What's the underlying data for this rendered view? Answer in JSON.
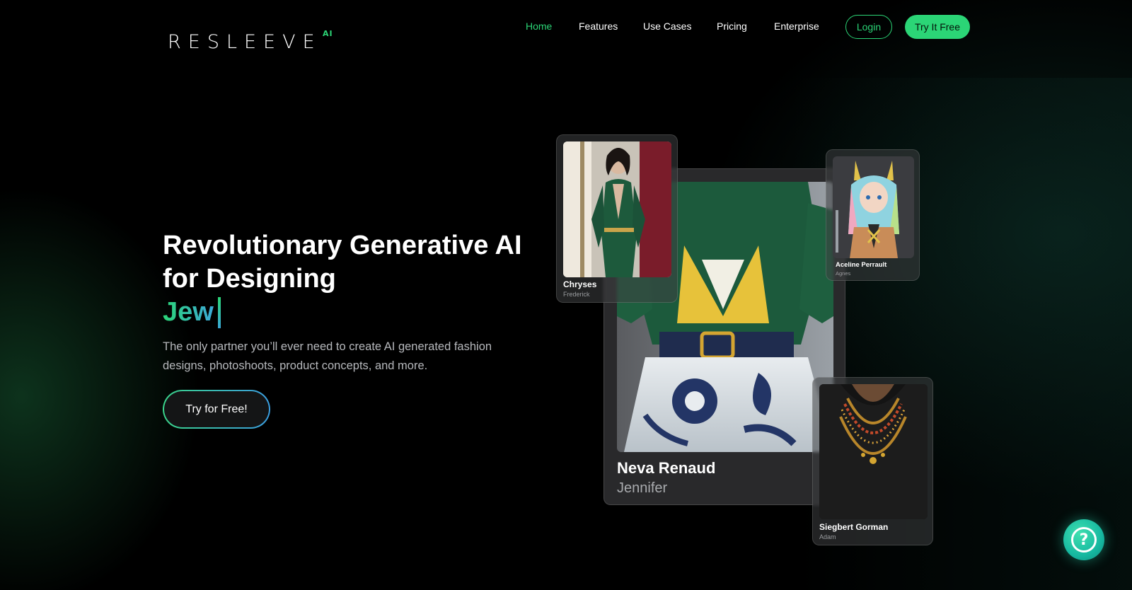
{
  "brand": {
    "logo_text": "RESLEEVE",
    "logo_super": "AI"
  },
  "nav": {
    "items": [
      {
        "label": "Home",
        "active": true
      },
      {
        "label": "Features"
      },
      {
        "label": "Use Cases"
      },
      {
        "label": "Pricing"
      },
      {
        "label": "Enterprise"
      }
    ],
    "login_label": "Login",
    "try_label": "Try It Free"
  },
  "hero": {
    "title": "Revolutionary Generative AI for Designing",
    "typed_text": "Jew",
    "subtitle": "The only partner you’ll ever need to create AI generated fashion designs, photoshoots, product concepts, and more.",
    "cta_label": "Try for Free!"
  },
  "cards": {
    "main": {
      "name": "Neva Renaud",
      "sub": "Jennifer"
    },
    "top_left": {
      "name": "Chryses",
      "sub": "Frederick"
    },
    "top_right": {
      "name": "Aceline Perrault",
      "sub": "Agnes"
    },
    "bottom_right": {
      "name": "Siegbert Gorman",
      "sub": "Adam"
    }
  },
  "help": {
    "icon": "question-icon"
  },
  "colors": {
    "accent": "#2bd576",
    "accent_blue": "#3ba8d8",
    "background": "#000000"
  }
}
